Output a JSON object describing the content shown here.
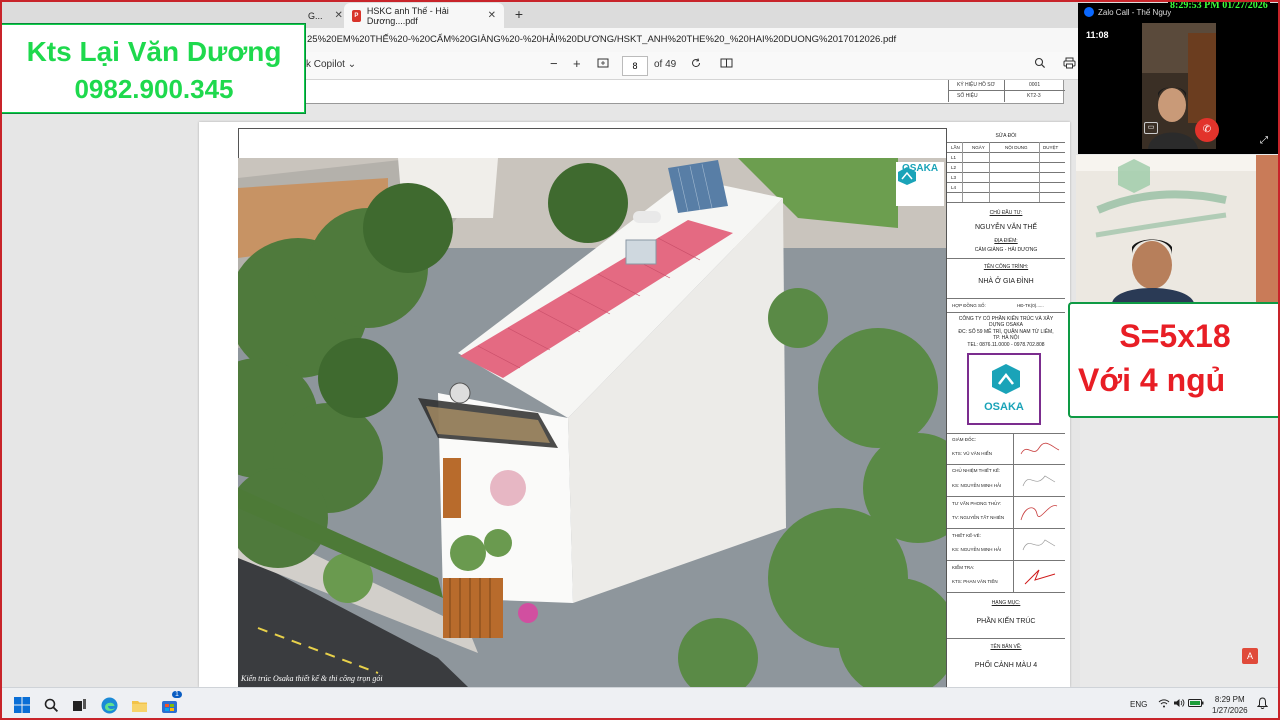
{
  "tabs": [
    {
      "label": "G..."
    },
    {
      "label": "HSKC anh Thế - Hải Dương....pdf",
      "active": true
    }
  ],
  "address": {
    "url": "25%20EM%20THẾ%20-%20CẨM%20GIÀNG%20-%20HẢI%20DƯƠNG/HSKT_ANH%20THE%20_%20HAI%20DUONG%2017012026.pdf"
  },
  "pdf_toolbar": {
    "copilot_label": "k Copilot",
    "page_current": "8",
    "page_total": "of 49"
  },
  "prev_page": {
    "row1_label": "KÝ HIỆU HỒ SƠ",
    "row1_value": "0001",
    "row2_label": "SỐ HIỆU",
    "row2_value": "KT2-3"
  },
  "render": {
    "watermark": "Kiến trúc Osaka thiết kế & thi công trọn gói",
    "logo": "OSAKA"
  },
  "title_block": {
    "revision_header": "SỬA ĐỔI",
    "rev_columns": [
      "LẦN",
      "NGÀY",
      "NỘI DUNG",
      "DUYỆT"
    ],
    "rev_rows": [
      "L1",
      "L2",
      "L3",
      "L4"
    ],
    "owner_label": "CHỦ ĐẦU TƯ:",
    "owner_name": "NGUYỄN VĂN THẾ",
    "location_label": "ĐỊA ĐIỂM:",
    "location": "CẨM GIÀNG - HẢI DƯƠNG",
    "project_label": "TÊN CÔNG TRÌNH:",
    "project": "NHÀ Ở GIA ĐÌNH",
    "contract_label": "HỢP ĐỒNG SỐ:",
    "contract_value": "HĐ-TK(0)......",
    "company": "CÔNG TY CỔ PHẦN KIẾN TRÚC VÀ XÂY DỰNG OSAKA",
    "address": "ĐC: SỐ 59 MỄ TRÌ, QUẬN NAM TỪ LIÊM, TP. HÀ NỘI",
    "phone": "TEL: 0876.11.0000 - 0978.702.808",
    "logo": "OSAKA",
    "roles": [
      {
        "role": "GIÁM ĐỐC:",
        "person": "KTS: VŨ VĂN HIỂN"
      },
      {
        "role": "CHỦ NHIỆM THIẾT KẾ:",
        "person": "KS: NGUYỄN MINH HẢI"
      },
      {
        "role": "TƯ VẤN PHONG THỦY:",
        "person": "TV: NGUYỄN TẤT NHIÊN"
      },
      {
        "role": "THIẾT KẾ-VẼ:",
        "person": "KS: NGUYỄN MINH HẢI"
      },
      {
        "role": "KIỂM TRA:",
        "person": "KTS: PHAN VĂN TIẾN"
      }
    ],
    "category_label": "HẠNG MỤC:",
    "category": "PHẦN KIẾN TRÚC",
    "drawing_label": "TÊN BẢN VẼ:",
    "drawing": "PHỐI CẢNH MÀU 4"
  },
  "overlay": {
    "brand_name": "Kts Lại Văn Dương",
    "brand_phone": "0982.900.345",
    "spec_line1": "S=5x18",
    "spec_line2": "Với 4 ngủ",
    "clock": "8:29:53 PM 01/27/2026"
  },
  "zalo": {
    "title": "Zalo Call - Thế Nguy",
    "timer": "11:08"
  },
  "taskbar": {
    "lang": "ENG",
    "time": "8:29 PM",
    "date": "1/27/2026",
    "badge": "1"
  },
  "colors": {
    "brand_green": "#1ed94d",
    "spec_red": "#e81e25",
    "osaka_teal": "#1aa3b8",
    "osaka_border": "#7b2d8e",
    "roof_pink": "#e46a82"
  },
  "icons": [
    "pdf-icon",
    "close-icon",
    "plus-icon",
    "search-icon",
    "print-icon",
    "rotate-icon",
    "fit-page-icon",
    "zoom-in-icon",
    "zoom-out-icon",
    "windows-start-icon",
    "explorer-icon",
    "edge-icon",
    "wifi-icon",
    "volume-icon",
    "battery-icon",
    "end-call-icon",
    "expand-icon",
    "acrobat-icon"
  ]
}
